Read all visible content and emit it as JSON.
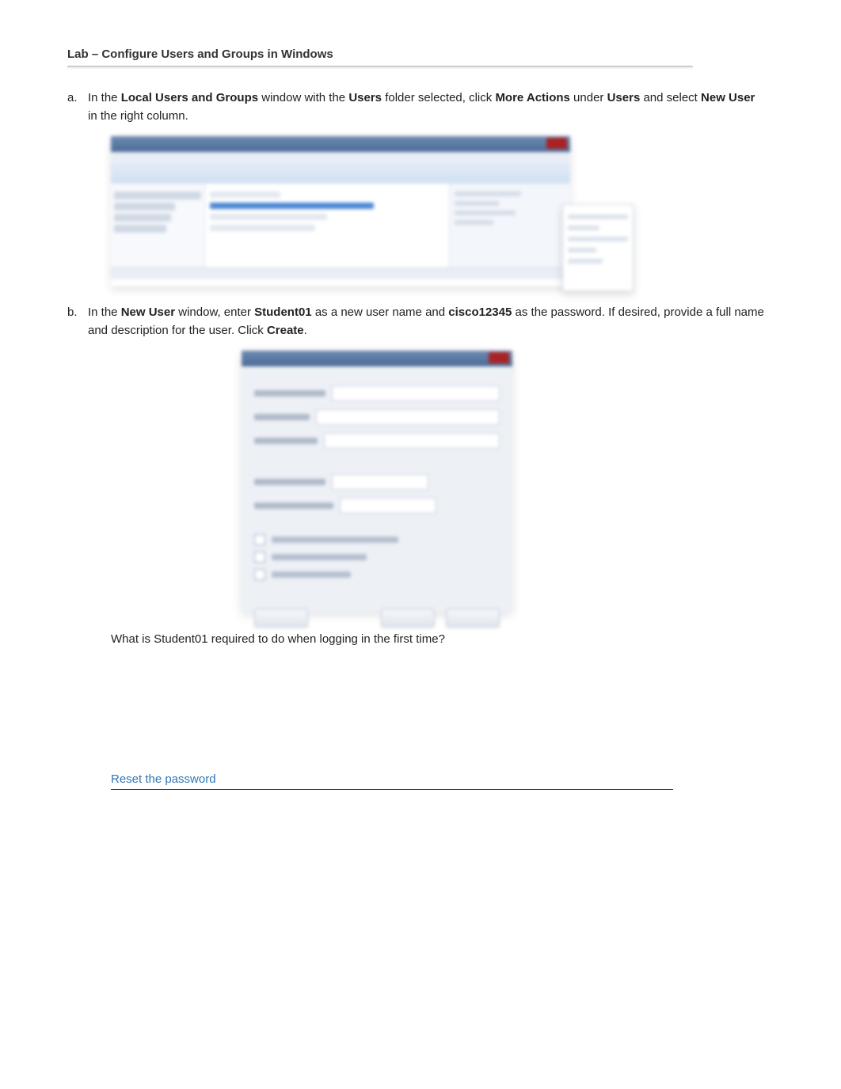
{
  "title": "Lab – Configure Users and Groups in Windows",
  "steps": {
    "a": {
      "letter": "a.",
      "pre1": "In the ",
      "b1": "Local Users and Groups",
      "mid1": " window with the ",
      "b2": "Users",
      "mid2": " folder selected, click ",
      "b3": "More Actions",
      "mid3": " under ",
      "b4": "Users",
      "mid4": " and select ",
      "b5": "New User",
      "post": " in the right column."
    },
    "b": {
      "letter": "b.",
      "pre1": "In the ",
      "b1": "New User",
      "mid1": " window, enter ",
      "b2": "Student01",
      "mid2": " as a new user name and ",
      "b3": "cisco12345",
      "mid3": " as the password. If desired, provide a full name and description for the user. Click ",
      "b4": "Create",
      "post": "."
    }
  },
  "question": "What is Student01 required to do when logging in the first time?",
  "answer": "Reset the password"
}
